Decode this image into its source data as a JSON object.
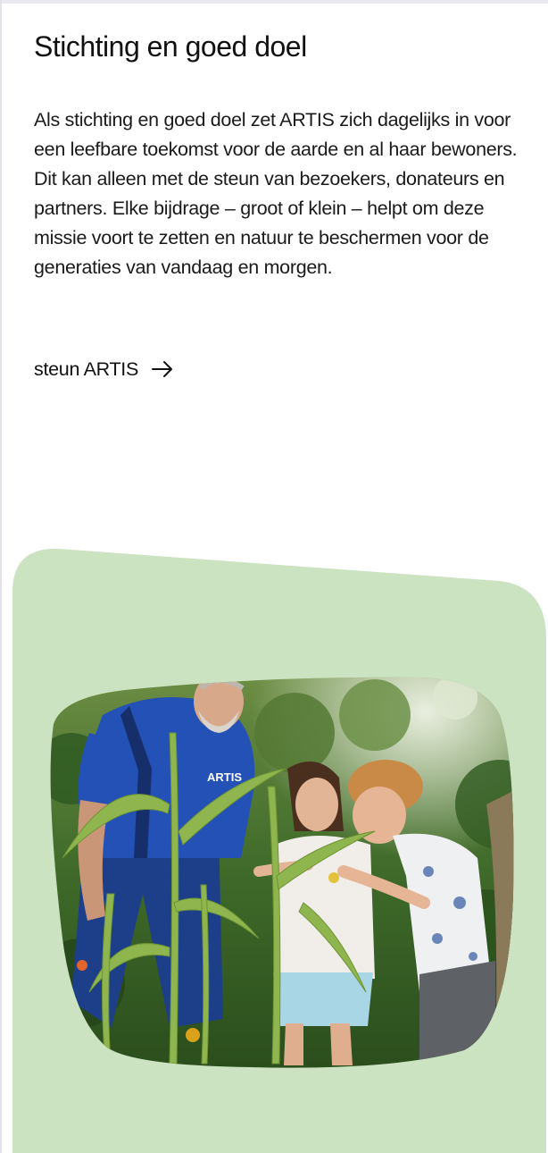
{
  "section": {
    "title": "Stichting en goed doel",
    "body": "Als stichting en goed doel zet ARTIS zich dagelijks in voor een leefbare toekomst voor de aarde en al haar bewoners. Dit kan alleen met de steun van bezoekers, donateurs en partners. Elke bijdrage – groot of klein – helpt om deze missie voort te zetten en natuur te beschermen voor de generaties van vandaag en morgen.",
    "cta_label": "steun ARTIS",
    "cta_icon": "arrow-right-icon"
  },
  "photo": {
    "shirt_text": "ARTIS"
  },
  "colors": {
    "panel_green": "#cce3c2",
    "text": "#111111",
    "background": "#ffffff"
  }
}
